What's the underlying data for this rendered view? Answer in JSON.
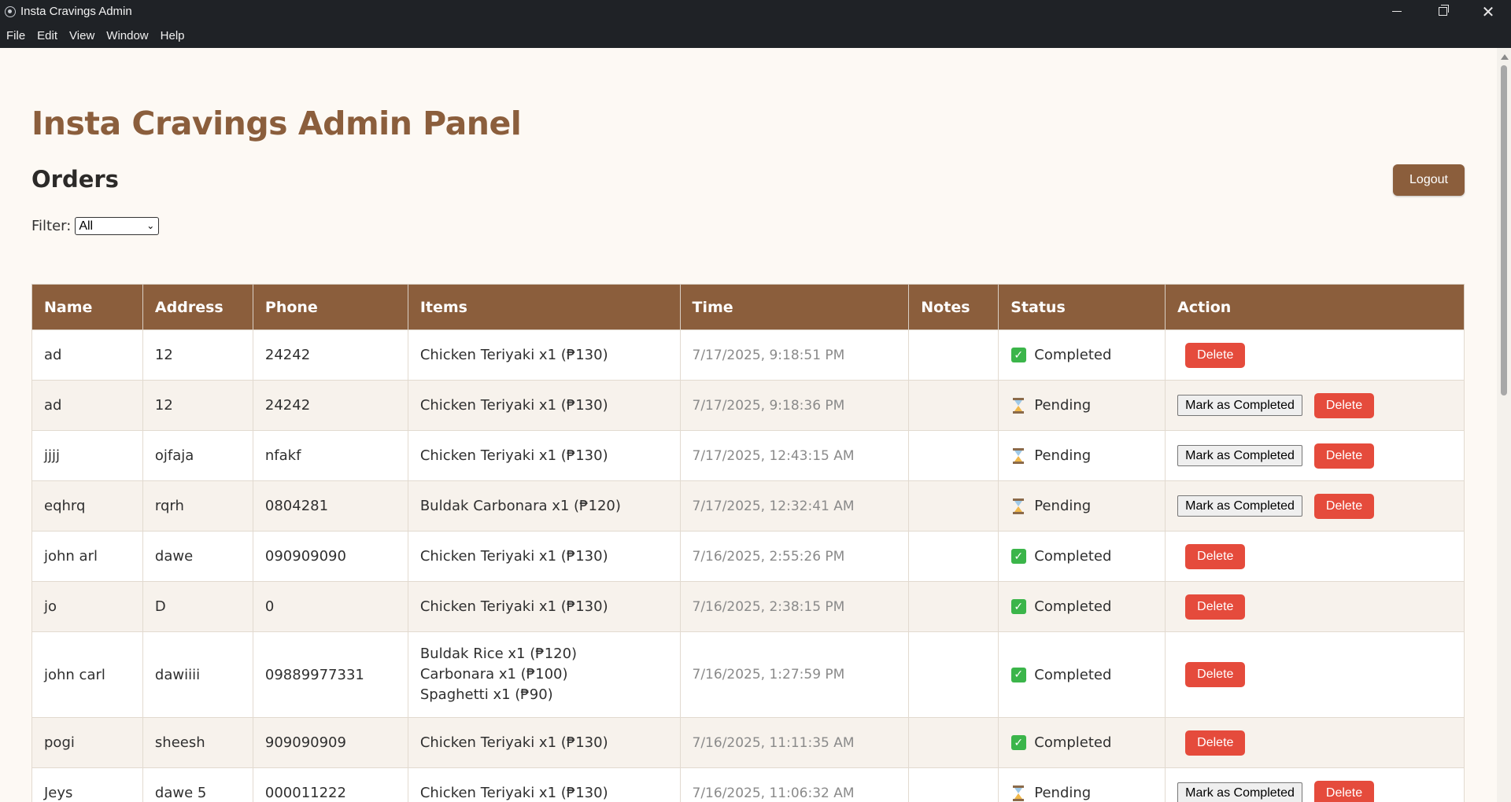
{
  "window": {
    "title": "Insta Cravings Admin"
  },
  "menu": [
    "File",
    "Edit",
    "View",
    "Window",
    "Help"
  ],
  "page": {
    "title": "Insta Cravings Admin Panel",
    "section": "Orders",
    "logout_label": "Logout",
    "filter_label": "Filter:",
    "filter_value": "All"
  },
  "table": {
    "headers": [
      "Name",
      "Address",
      "Phone",
      "Items",
      "Time",
      "Notes",
      "Status",
      "Action"
    ],
    "mark_label": "Mark as Completed",
    "delete_label": "Delete",
    "rows": [
      {
        "name": "ad",
        "address": "12",
        "phone": "24242",
        "items": [
          "Chicken Teriyaki x1 (₱130)"
        ],
        "time": "7/17/2025, 9:18:51 PM",
        "notes": "",
        "status": "Completed"
      },
      {
        "name": "ad",
        "address": "12",
        "phone": "24242",
        "items": [
          "Chicken Teriyaki x1 (₱130)"
        ],
        "time": "7/17/2025, 9:18:36 PM",
        "notes": "",
        "status": "Pending"
      },
      {
        "name": "jjjj",
        "address": "ojfaja",
        "phone": "nfakf",
        "items": [
          "Chicken Teriyaki x1 (₱130)"
        ],
        "time": "7/17/2025, 12:43:15 AM",
        "notes": "",
        "status": "Pending"
      },
      {
        "name": "eqhrq",
        "address": "rqrh",
        "phone": "0804281",
        "items": [
          "Buldak Carbonara x1 (₱120)"
        ],
        "time": "7/17/2025, 12:32:41 AM",
        "notes": "",
        "status": "Pending"
      },
      {
        "name": "john arl",
        "address": "dawe",
        "phone": "090909090",
        "items": [
          "Chicken Teriyaki x1 (₱130)"
        ],
        "time": "7/16/2025, 2:55:26 PM",
        "notes": "",
        "status": "Completed"
      },
      {
        "name": "jo",
        "address": "D",
        "phone": "0",
        "items": [
          "Chicken Teriyaki x1 (₱130)"
        ],
        "time": "7/16/2025, 2:38:15 PM",
        "notes": "",
        "status": "Completed"
      },
      {
        "name": "john carl",
        "address": "dawiiii",
        "phone": "09889977331",
        "items": [
          "Buldak Rice x1 (₱120)",
          "Carbonara x1 (₱100)",
          "Spaghetti x1 (₱90)"
        ],
        "time": "7/16/2025, 1:27:59 PM",
        "notes": "",
        "status": "Completed"
      },
      {
        "name": "pogi",
        "address": "sheesh",
        "phone": "909090909",
        "items": [
          "Chicken Teriyaki x1 (₱130)"
        ],
        "time": "7/16/2025, 11:11:35 AM",
        "notes": "",
        "status": "Completed"
      },
      {
        "name": "Jeys",
        "address": "dawe 5",
        "phone": "000011222",
        "items": [
          "Chicken Teriyaki x1 (₱130)"
        ],
        "time": "7/16/2025, 11:06:32 AM",
        "notes": "",
        "status": "Pending"
      }
    ]
  },
  "colors": {
    "brand": "#8b5e3c",
    "delete": "#e54b3c",
    "completed": "#3bb54a"
  }
}
